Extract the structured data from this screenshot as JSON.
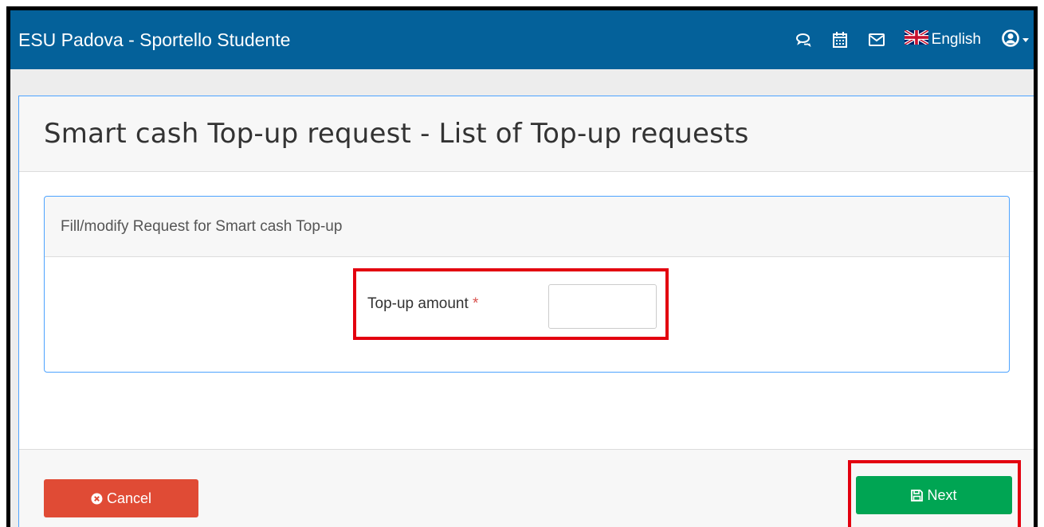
{
  "navbar": {
    "brand": "ESU Padova - Sportello Studente",
    "language": "English",
    "icons": [
      "chat-icon",
      "calendar-icon",
      "mail-icon",
      "uk-flag-icon",
      "user-circle-icon",
      "caret-down-icon"
    ],
    "background": "#04619a"
  },
  "page": {
    "title": "Smart cash Top-up request - List of Top-up requests"
  },
  "form": {
    "panel_title": "Fill/modify Request for Smart cash Top-up",
    "amount_label": "Top-up amount",
    "required_mark": "*",
    "amount_value": "",
    "amount_placeholder": ""
  },
  "footer": {
    "cancel_label": "Cancel",
    "next_label": "Next",
    "cancel_color": "#e04b35",
    "next_color": "#00a553"
  },
  "highlight_color": "#e3000f"
}
